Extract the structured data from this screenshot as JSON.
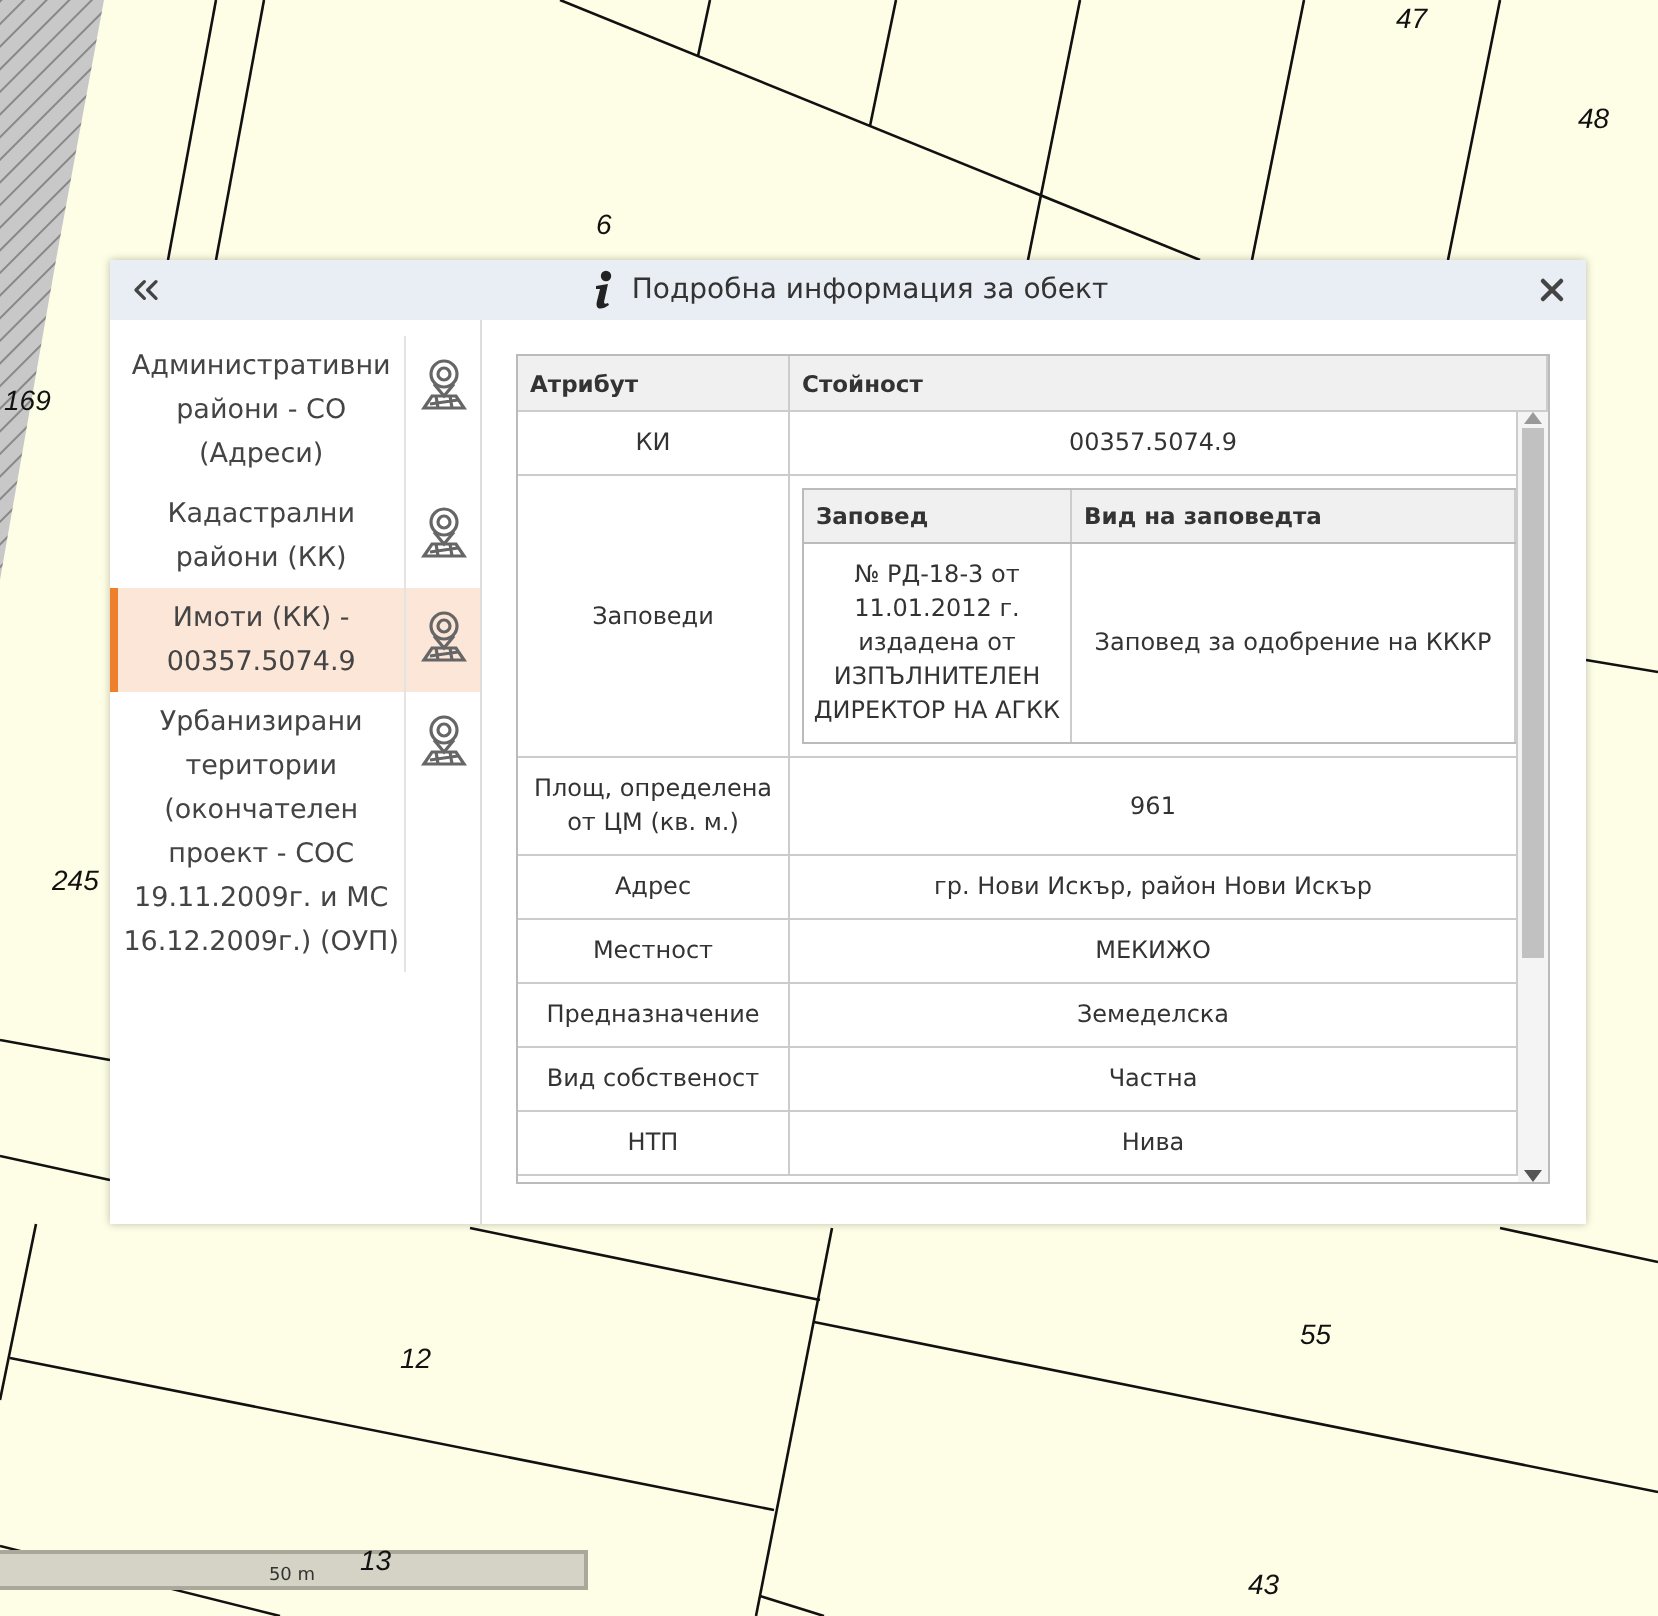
{
  "map": {
    "parcel_labels": [
      "47",
      "48",
      "6",
      "169",
      "245",
      "12",
      "55",
      "13",
      "43"
    ],
    "scale": "50 m"
  },
  "dialog": {
    "title": "Подробна информация за обект",
    "layers": [
      {
        "label": "Административни райони - СО (Адреси)",
        "selected": false
      },
      {
        "label": "Кадастрални райони (КК)",
        "selected": false
      },
      {
        "label": "Имоти (КК) - 00357.5074.9",
        "selected": true
      },
      {
        "label": "Урбанизирани територии (окончателен проект - СОС 19.11.2009г. и МС 16.12.2009г.) (ОУП)",
        "selected": false
      }
    ],
    "table": {
      "columns": [
        "Атрибут",
        "Стойност"
      ],
      "rows": [
        {
          "kind": "text",
          "attribute": "КИ",
          "value": "00357.5074.9"
        },
        {
          "kind": "nested",
          "attribute": "Заповеди",
          "columns": [
            "Заповед",
            "Вид на заповедта"
          ],
          "rows": [
            [
              "№ РД-18-3 от 11.01.2012 г. издадена от ИЗПЪЛНИТЕЛЕН ДИРЕКТОР НА АГКК",
              "Заповед за одобрение на КККР"
            ]
          ]
        },
        {
          "kind": "text",
          "attribute": "Площ, определена от ЦМ (кв. м.)",
          "value": "961"
        },
        {
          "kind": "text",
          "attribute": "Адрес",
          "value": "гр. Нови Искър, район Нови Искър"
        },
        {
          "kind": "text",
          "attribute": "Местност",
          "value": "МЕКИЖО"
        },
        {
          "kind": "text",
          "attribute": "Предназначение",
          "value": "Земеделска"
        },
        {
          "kind": "text",
          "attribute": "Вид собственост",
          "value": "Частна"
        },
        {
          "kind": "text",
          "attribute": "НТП",
          "value": "Нива"
        }
      ]
    }
  }
}
